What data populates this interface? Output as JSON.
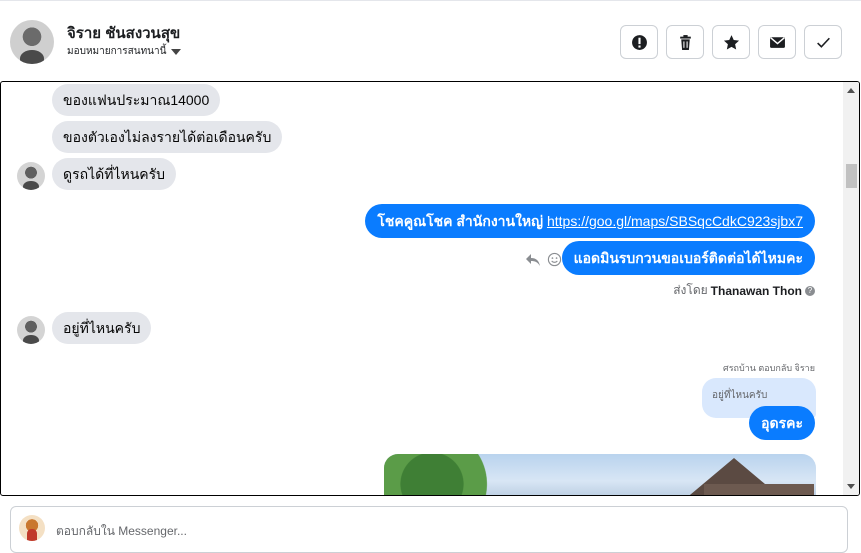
{
  "header": {
    "contact_name": "จิราย ชันสงวนสุข",
    "assign_label": "มอบหมายการสนทนานี้",
    "actions": [
      {
        "icon": "alert-icon",
        "name": "mark-spam-button"
      },
      {
        "icon": "trash-icon",
        "name": "delete-button"
      },
      {
        "icon": "star-icon",
        "name": "star-button"
      },
      {
        "icon": "envelope-icon",
        "name": "mark-unread-button"
      },
      {
        "icon": "check-icon",
        "name": "mark-done-button"
      }
    ]
  },
  "messages": {
    "incoming_1": "ของแฟนประมาณ14000",
    "incoming_2": "ของตัวเองไม่ลงรายได้ต่อเดือนครับ",
    "incoming_3": "ดูรถได้ที่ไหนครับ",
    "outgoing_1_text": "โชคคูณโชค สำนักงานใหญ่ ",
    "outgoing_1_link": "https://goo.gl/maps/SBSqcCdkC923sjbx7",
    "outgoing_2": "แอดมินรบกวนขอเบอร์ติดต่อได้ไหมคะ",
    "sent_by_prefix": "ส่งโดย",
    "sent_by_name": "Thanawan Thon",
    "incoming_4": "อยู่ที่ไหนครับ",
    "reply_meta": "ศรถบ้าน ตอบกลับ จิราย",
    "quoted_text": "อยู่ที่ไหนครับ",
    "outgoing_3": "อุดรคะ"
  },
  "composer": {
    "placeholder": "ตอบกลับใน Messenger..."
  },
  "colors": {
    "outgoing_bubble": "#0a7cff",
    "incoming_bubble": "#e4e6eb",
    "quoted_bubble": "#d9e8fd"
  }
}
